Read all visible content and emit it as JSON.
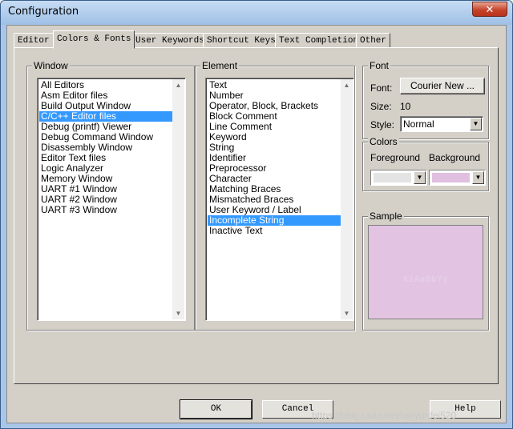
{
  "window": {
    "title": "Configuration",
    "close_glyph": "✕"
  },
  "tabs": [
    {
      "label": "Editor"
    },
    {
      "label": "Colors & Fonts"
    },
    {
      "label": "User Keywords"
    },
    {
      "label": "Shortcut Keys"
    },
    {
      "label": "Text Completion"
    },
    {
      "label": "Other"
    }
  ],
  "active_tab": "Colors & Fonts",
  "window_group": {
    "label": "Window",
    "items": [
      "All Editors",
      "Asm Editor files",
      "Build Output Window",
      "C/C++ Editor files",
      "Debug (printf) Viewer",
      "Debug Command Window",
      "Disassembly Window",
      "Editor Text files",
      "Logic Analyzer",
      "Memory Window",
      "UART #1 Window",
      "UART #2 Window",
      "UART #3 Window"
    ],
    "selected": "C/C++ Editor files"
  },
  "element_group": {
    "label": "Element",
    "items": [
      "Text",
      "Number",
      "Operator, Block, Brackets",
      "Block Comment",
      "Line Comment",
      "Keyword",
      "String",
      "Identifier",
      "Preprocessor",
      "Character",
      "Matching Braces",
      "Mismatched Braces",
      "User Keyword / Label",
      "Incomplete String",
      "Inactive Text"
    ],
    "selected": "Incomplete String"
  },
  "font_group": {
    "label": "Font",
    "font_label": "Font:",
    "font_button": "Courier New ...",
    "size_label": "Size:",
    "size_value": "10",
    "style_label": "Style:",
    "style_value": "Normal"
  },
  "colors_group": {
    "label": "Colors",
    "foreground_label": "Foreground",
    "background_label": "Background",
    "foreground_color": "#e4e4e4",
    "background_color": "#e0bfe0"
  },
  "sample_group": {
    "label": "Sample",
    "text": "XiAaBbYy",
    "background_color": "#e2c3e2"
  },
  "buttons": {
    "ok": "OK",
    "cancel": "Cancel",
    "help": "Help"
  },
  "watermark": "https://blog.csdn.net/ranyunfei520"
}
